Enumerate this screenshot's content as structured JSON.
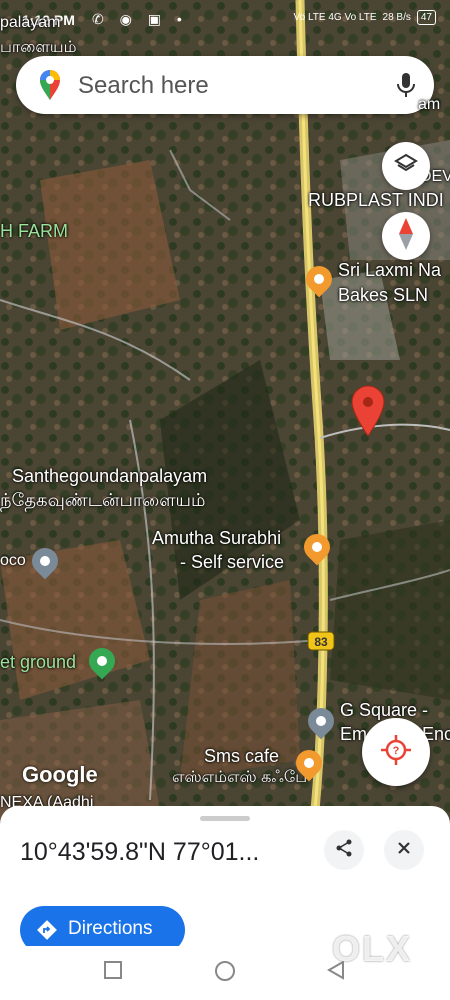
{
  "status_bar": {
    "time": "1:12 PM",
    "icons": "✆ ◉ ▣ •",
    "network": "Vo LTE 4G Vo LTE",
    "speed": "28 B/s",
    "battery": "47"
  },
  "search": {
    "placeholder": "Search here",
    "icon": "google-maps-pin-icon",
    "mic_icon": "mic-icon"
  },
  "map": {
    "labels": {
      "top_left": "palayam",
      "top_left_tamil": "பாளையம்",
      "farm": "H FARM",
      "rubplast": "RUBPLAST INDI",
      "sri_laxmi_1": "Sri Laxmi Na",
      "sri_laxmi_2": "Bakes SLN",
      "santhe": "Santhegoundanpalayam",
      "santhe_tamil": "ந்தேகவுண்டன்பாளையம்",
      "amutha_1": "Amutha Surabhi",
      "amutha_2": "- Self service",
      "left_poi": "oco",
      "market_ground": "et ground",
      "highway": "83",
      "gsquare_1": "G Square -",
      "gsquare_2": "Em",
      "gsquare_3": "Enc",
      "sms_cafe": "Sms cafe",
      "sms_cafe_tamil": "எஸ்எம்எஸ் கஃபே",
      "bottom_left": "NEXA (Aadhi",
      "dev": "DEV",
      "am": "am"
    },
    "google_logo": "Google",
    "layers_icon": "layers-icon",
    "compass_icon": "compass-icon",
    "help_icon": "location-help-icon",
    "colors": {
      "road": "#d8c468",
      "pin": "#ea4335",
      "food_poi": "#f29a2e",
      "poi_gray": "#7a8a99",
      "park_poi": "#34a853"
    }
  },
  "sheet": {
    "coordinates": "10°43'59.8\"N 77°01...",
    "share_icon": "share-icon",
    "close_icon": "close-icon",
    "directions_label": "Directions",
    "directions_icon": "directions-icon"
  },
  "navbar": {
    "back": "back-icon",
    "home": "home-icon",
    "recents": "recents-icon"
  },
  "watermark": "OLX"
}
